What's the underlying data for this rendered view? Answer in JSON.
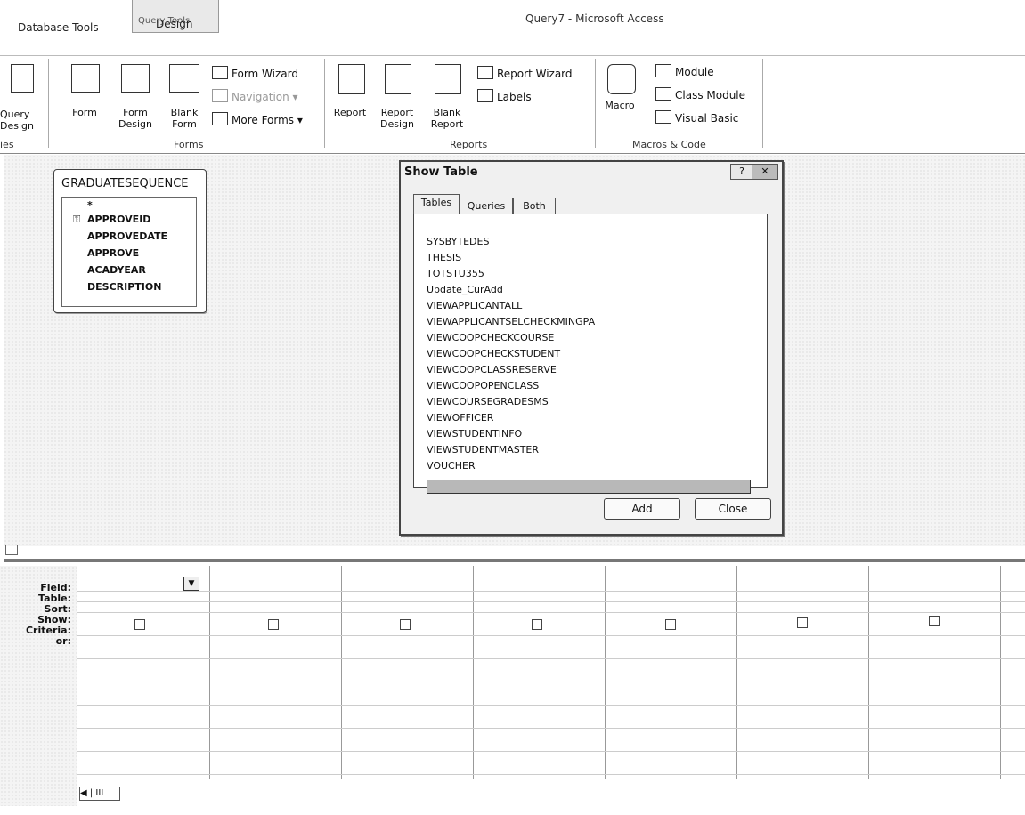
{
  "app_title": "Query7 - Microsoft Access",
  "contextual_tab": "Query Tools",
  "tabs": [
    "Database Tools",
    "Design"
  ],
  "ribbon": {
    "query_design": "Query Design",
    "queries_group": "ies",
    "forms": {
      "form": "Form",
      "form_design": "Form Design",
      "blank_form": "Blank Form",
      "form_wizard": "Form Wizard",
      "navigation": "Navigation",
      "more_forms": "More Forms",
      "group": "Forms"
    },
    "reports": {
      "report": "Report",
      "report_design": "Report Design",
      "blank_report": "Blank Report",
      "report_wizard": "Report Wizard",
      "labels": "Labels",
      "group": "Reports"
    },
    "macros": {
      "macro": "Macro",
      "module": "Module",
      "class_module": "Class Module",
      "visual_basic": "Visual Basic",
      "group": "Macros & Code"
    }
  },
  "field_list": {
    "title": "GRADUATESEQUENCE",
    "fields": [
      "*",
      "APPROVEID",
      "APPROVEDATE",
      "APPROVE",
      "ACADYEAR",
      "DESCRIPTION"
    ]
  },
  "dialog": {
    "title": "Show Table",
    "help": "?",
    "tabs": [
      "Tables",
      "Queries",
      "Both"
    ],
    "items": [
      "SYSBYTEDES",
      "THESIS",
      "TOTSTU355",
      "Update_CurAdd",
      "VIEWAPPLICANTALL",
      "VIEWAPPLICANTSELCHECKMINGPA",
      "VIEWCOOPCHECKCOURSE",
      "VIEWCOOPCHECKSTUDENT",
      "VIEWCOOPCLASSRESERVE",
      "VIEWCOOPOPENCLASS",
      "VIEWCOURSEGRADESMS",
      "VIEWOFFICER",
      "VIEWSTUDENTINFO",
      "VIEWSTUDENTMASTER",
      "VOUCHER"
    ],
    "selected": "VIEWSTUDENTINFO",
    "add": "Add",
    "close": "Close"
  },
  "grid": {
    "row_labels": [
      "Field:",
      "Table:",
      "Sort:",
      "Show:",
      "Criteria:",
      "or:"
    ],
    "nav": "◀ | III"
  }
}
